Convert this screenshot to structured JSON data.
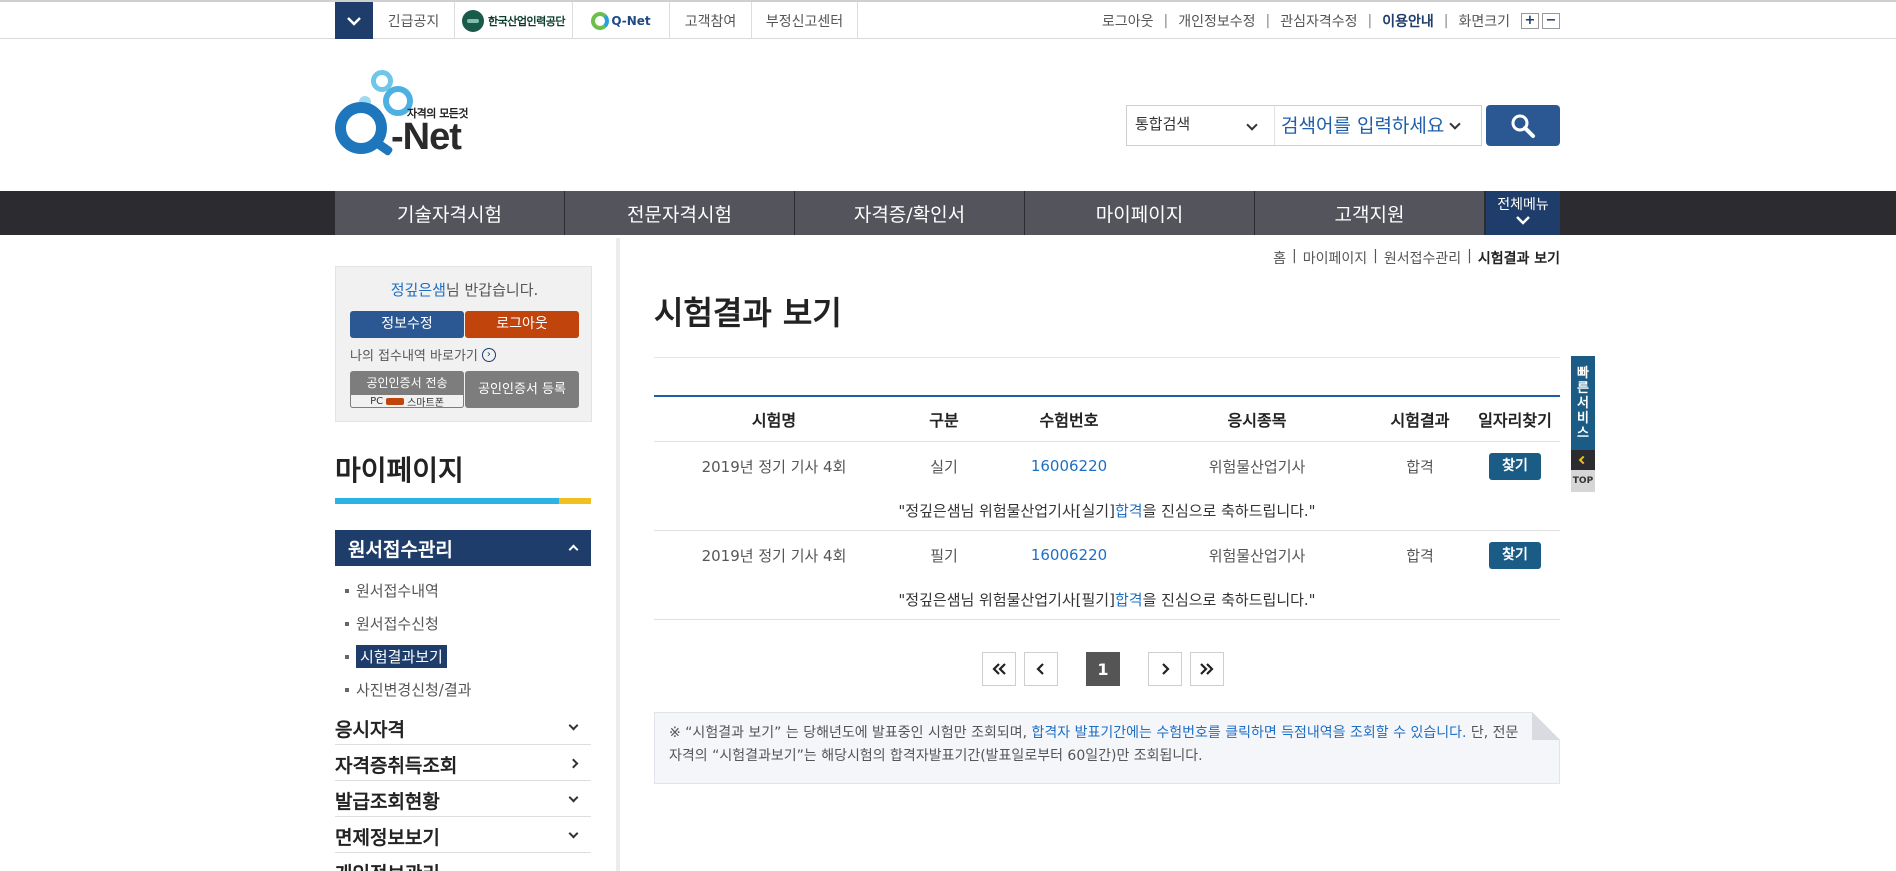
{
  "topbar": {
    "links": [
      "긴급공지",
      "고객참여",
      "부정신고센터"
    ],
    "logo1_text": "한국산업인력공단",
    "logo2_text": "Q-Net",
    "right": [
      "로그아웃",
      "개인정보수정",
      "관심자격수정",
      "이용안내",
      "화면크기"
    ],
    "zoom_in": "+",
    "zoom_out": "−"
  },
  "header": {
    "logo_tag": "자격의 모든것",
    "logo_name": "-Net",
    "search_scope": "통합검색",
    "search_placeholder": "검색어를 입력하세요"
  },
  "gnb": {
    "items": [
      "기술자격시험",
      "전문자격시험",
      "자격증/확인서",
      "마이페이지",
      "고객지원"
    ],
    "all_menu": "전체메뉴"
  },
  "welcome": {
    "user": "정깊은샘",
    "greeting": "님 반갑습니다.",
    "edit_btn": "정보수정",
    "logout_btn": "로그아웃",
    "my_apply": "나의 접수내역 바로가기",
    "cert_send": "공인인증서 전송",
    "cert_send_sub_pc": "PC",
    "cert_send_sub_phone": "스마트폰",
    "cert_register": "공인인증서 등록"
  },
  "lnb": {
    "title": "마이페이지",
    "section": "원서접수관리",
    "sub_items": [
      "원서접수내역",
      "원서접수신청",
      "시험결과보기",
      "사진변경신청/결과"
    ],
    "items": [
      "응시자격",
      "자격증취득조회",
      "발급조회현황",
      "면제정보보기",
      "개인정보관리"
    ]
  },
  "breadcrumb": [
    "홈",
    "|",
    "마이페이지",
    "|",
    "원서접수관리",
    "|",
    "시험결과 보기"
  ],
  "page_title": "시험결과 보기",
  "table": {
    "headers": [
      "시험명",
      "구분",
      "수험번호",
      "응시종목",
      "시험결과",
      "일자리찾기"
    ],
    "rows": [
      {
        "exam": "2019년 정기 기사 4회",
        "type": "실기",
        "number": "16006220",
        "subject": "위험물산업기사",
        "result": "합격",
        "btn": "찾기",
        "msg_pre": "\"정깊은샘님 위험물산업기사[실기] ",
        "msg_hl": "합격",
        "msg_post": "을 진심으로 축하드립니다.\""
      },
      {
        "exam": "2019년 정기 기사 4회",
        "type": "필기",
        "number": "16006220",
        "subject": "위험물산업기사",
        "result": "합격",
        "btn": "찾기",
        "msg_pre": "\"정깊은샘님 위험물산업기사[필기] ",
        "msg_hl": "합격",
        "msg_post": "을 진심으로 축하드립니다.\""
      }
    ]
  },
  "pager": {
    "current": "1"
  },
  "note": {
    "pre": "※ “시험결과 보기” 는 당해년도에 발표중인 시험만 조회되며, ",
    "hl": "합격자 발표기간에는 수험번호를 클릭하면 득점내역을 조회할 수 있습니다.",
    "post": " 단, 전문자격의 “시험결과보기”는 해당시험의 합격자발표기간(발표일로부터 60일간)만 조회됩니다."
  },
  "quick": {
    "label": "빠른서비스",
    "top": "TOP"
  },
  "colors": {
    "navy": "#1f3d6b",
    "accent_blue": "#1f6fc4",
    "logout_orange": "#c0440c",
    "gnb_bg": "#2c2c30"
  },
  "icons": [
    "chevron-down-icon",
    "search-icon",
    "arrow-right-circle-icon",
    "first-page-icon",
    "prev-page-icon",
    "next-page-icon",
    "last-page-icon",
    "chevron-left-icon"
  ]
}
